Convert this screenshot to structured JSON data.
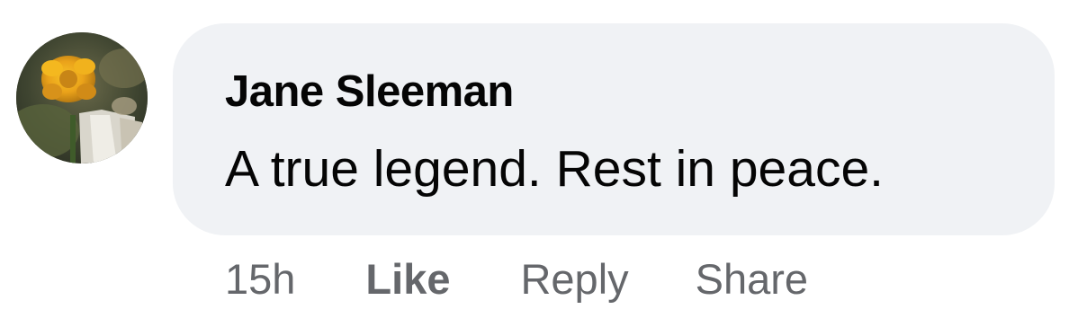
{
  "comment": {
    "author": "Jane Sleeman",
    "text": "A true legend. Rest in peace.",
    "timestamp": "15h",
    "actions": {
      "like": "Like",
      "reply": "Reply",
      "share": "Share"
    },
    "avatar_icon": "profile-photo-yellow-flower"
  },
  "colors": {
    "bubble_background": "#f0f2f5",
    "primary_text": "#050505",
    "secondary_text": "#65676b"
  }
}
